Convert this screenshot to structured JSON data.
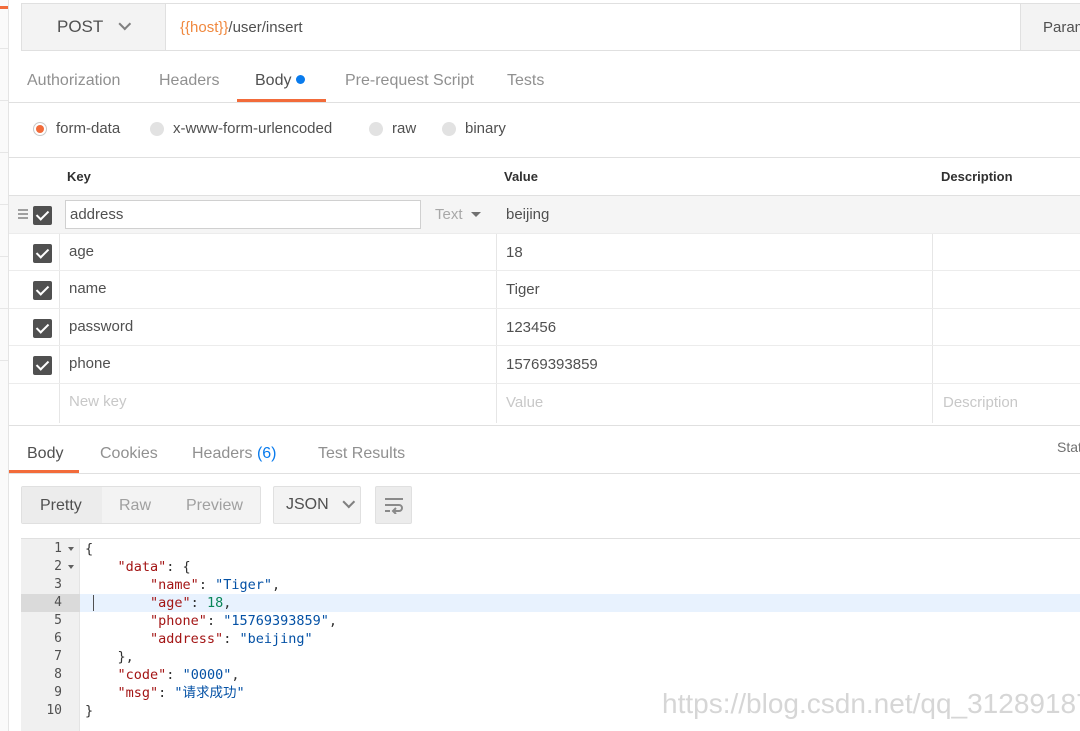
{
  "request": {
    "method": "POST",
    "url_var": "{{host}}",
    "url_path": "/user/insert",
    "params_label": "Param"
  },
  "request_tabs": [
    {
      "label": "Authorization"
    },
    {
      "label": "Headers"
    },
    {
      "label": "Body"
    },
    {
      "label": "Pre-request Script"
    },
    {
      "label": "Tests"
    }
  ],
  "body_types": [
    {
      "label": "form-data",
      "selected": true
    },
    {
      "label": "x-www-form-urlencoded",
      "selected": false
    },
    {
      "label": "raw",
      "selected": false
    },
    {
      "label": "binary",
      "selected": false
    }
  ],
  "table": {
    "headers": {
      "key": "Key",
      "value": "Value",
      "description": "Description"
    },
    "type_label": "Text",
    "rows": [
      {
        "key": "address",
        "value": "beijing"
      },
      {
        "key": "age",
        "value": "18"
      },
      {
        "key": "name",
        "value": "Tiger"
      },
      {
        "key": "password",
        "value": "123456"
      },
      {
        "key": "phone",
        "value": "15769393859"
      }
    ],
    "placeholders": {
      "key": "New key",
      "value": "Value",
      "description": "Description"
    }
  },
  "response_tabs": {
    "body": "Body",
    "cookies": "Cookies",
    "headers": "Headers",
    "headers_count": "(6)",
    "test_results": "Test Results",
    "status_cut": "Stat"
  },
  "format": {
    "pretty": "Pretty",
    "raw": "Raw",
    "preview": "Preview",
    "language": "JSON"
  },
  "code_lines": [
    {
      "n": "1",
      "text": "{"
    },
    {
      "n": "2",
      "text": "    \"data\": {"
    },
    {
      "n": "3",
      "text": "        \"name\": \"Tiger\","
    },
    {
      "n": "4",
      "text": "        \"age\": 18,"
    },
    {
      "n": "5",
      "text": "        \"phone\": \"15769393859\","
    },
    {
      "n": "6",
      "text": "        \"address\": \"beijing\""
    },
    {
      "n": "7",
      "text": "    },"
    },
    {
      "n": "8",
      "text": "    \"code\": \"0000\","
    },
    {
      "n": "9",
      "text": "    \"msg\": \"请求成功\""
    },
    {
      "n": "10",
      "text": "}"
    }
  ],
  "watermark": "https://blog.csdn.net/qq_31289187",
  "colors": {
    "accent": "#f26b3a",
    "blue": "#097bed"
  }
}
